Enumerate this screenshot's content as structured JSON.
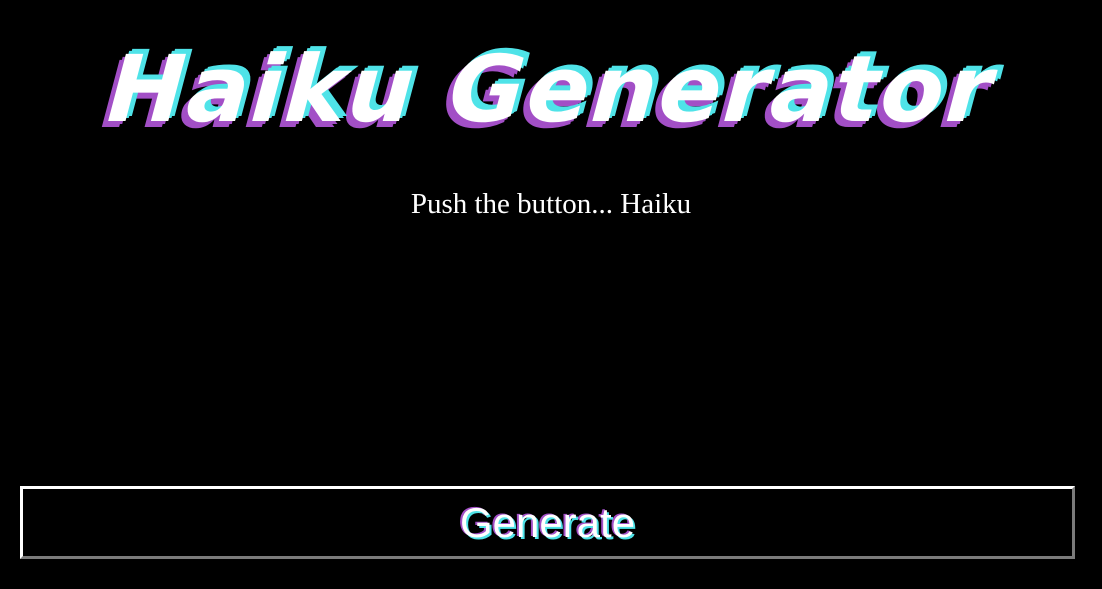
{
  "header": {
    "title": "Haiku Generator",
    "subtitle": "Push the button... Haiku"
  },
  "output": {
    "haiku_lines": []
  },
  "actions": {
    "generate_label": "Generate"
  },
  "colors": {
    "background": "#000000",
    "text": "#ffffff",
    "accent_cyan": "#4fe3e8",
    "accent_purple": "#a24fc6",
    "button_border_light": "#ffffff",
    "button_border_dark": "#7b7b7b"
  }
}
